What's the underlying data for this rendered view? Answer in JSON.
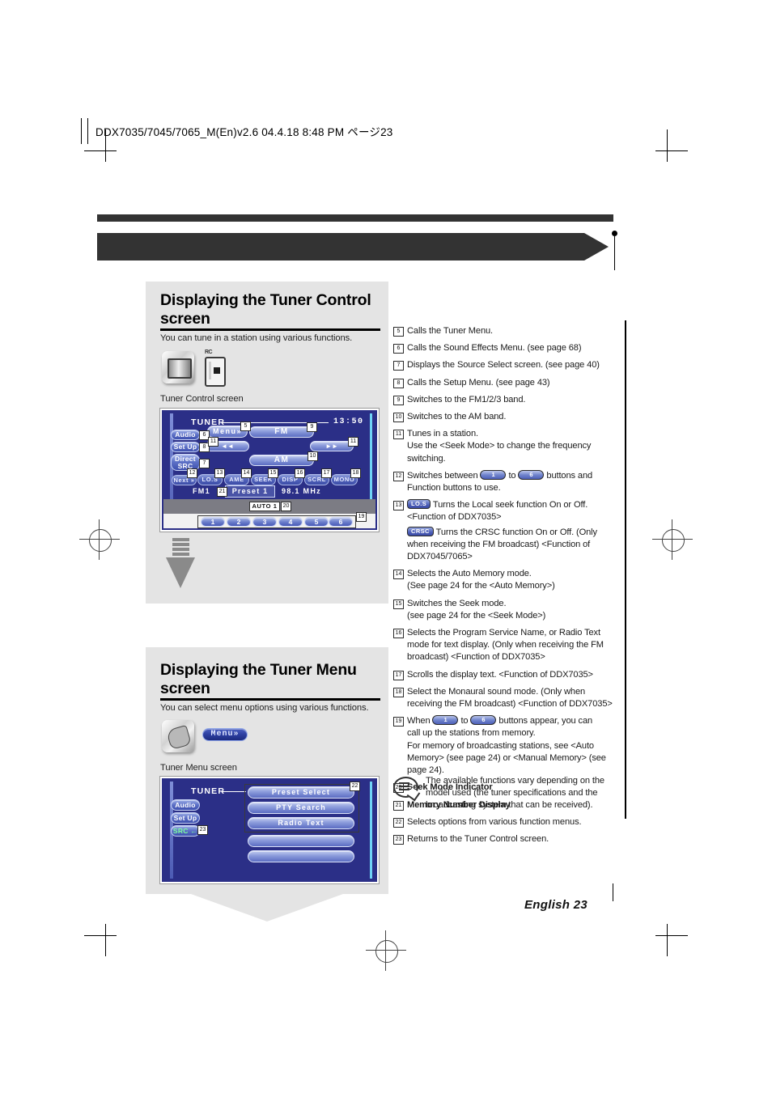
{
  "print_header": "DDX7035/7045/7065_M(En)v2.6  04.4.18  8:48 PM  ページ23",
  "footer": "English 23",
  "section1": {
    "heading": "Displaying the Tuner Control screen",
    "lead": "You can tune in a station using various functions.",
    "caption": "Tuner Control screen",
    "remote_icon_label": "RC",
    "screen": {
      "title": "TUNER",
      "clock": "13:50",
      "menu_button": "Menu»",
      "side_buttons": [
        "Audio",
        "Set Up",
        "Direct SRC"
      ],
      "band_fm": "FM",
      "band_am": "AM",
      "seek_left": "◄◄",
      "seek_right": "►►",
      "next_button": "Next »",
      "function_buttons": [
        "LO.S",
        "AME",
        "SEEK",
        "DISP",
        "SCRL",
        "MONO"
      ],
      "band_label": "FM1",
      "preset_label": "Preset 1",
      "frequency": "98.1 MHz",
      "auto_indicator": "AUTO 1",
      "preset_numbers": [
        "1",
        "2",
        "3",
        "4",
        "5",
        "6"
      ],
      "callouts": {
        "menu": "5",
        "audio": "6",
        "direct_src": "7",
        "setup": "8",
        "fm": "9",
        "am": "10",
        "seek_left": "11",
        "seek_right": "11",
        "next": "12",
        "los": "13",
        "ame": "14",
        "seek": "15",
        "disp": "16",
        "scrl": "17",
        "mono": "18",
        "presets": "19",
        "auto": "20",
        "preset_num": "21"
      }
    }
  },
  "section2": {
    "heading": "Displaying the Tuner Menu screen",
    "lead": "You can select menu options using various functions.",
    "caption": "Tuner Menu screen",
    "menu_pill": "Menu»",
    "screen": {
      "title": "TUNER",
      "side_buttons": [
        "Audio",
        "Set Up"
      ],
      "src_button": "SRC ←",
      "menu_items": [
        "Preset Select",
        "PTY Search",
        "Radio Text"
      ],
      "callouts": {
        "menu_list": "22",
        "src": "23"
      }
    }
  },
  "items": [
    {
      "num": "5",
      "lines": [
        {
          "text": "Calls the Tuner Menu."
        }
      ]
    },
    {
      "num": "6",
      "lines": [
        {
          "text": "Calls the Sound Effects Menu. (see page 68)"
        }
      ]
    },
    {
      "num": "7",
      "lines": [
        {
          "text": "Displays the Source Select screen. (see page 40)"
        }
      ]
    },
    {
      "num": "8",
      "lines": [
        {
          "text": "Calls the Setup Menu. (see page 43)"
        }
      ]
    },
    {
      "num": "9",
      "lines": [
        {
          "text": "Switches to the FM1/2/3 band."
        }
      ]
    },
    {
      "num": "10",
      "lines": [
        {
          "text": "Switches to the AM band."
        }
      ]
    },
    {
      "num": "11",
      "lines": [
        {
          "text": "Tunes in a station."
        },
        {
          "text": "Use the <Seek Mode> to change the frequency switching."
        }
      ]
    },
    {
      "num": "12",
      "pill_line": {
        "pre": "Switches between",
        "pill1": "1",
        "mid": "to",
        "pill2": "6",
        "post": "buttons and"
      },
      "lines": [
        {
          "text": "Function buttons to use."
        }
      ]
    },
    {
      "num": "13",
      "tag_line": {
        "tag": "LO.S",
        "text": "Turns the Local seek function On or Off. <Function of DDX7035>"
      },
      "tag_line2": {
        "tag": "CRSC",
        "text": "Turns the CRSC function On or Off. (Only when receiving the FM broadcast) <Function of DDX7045/7065>"
      },
      "lines": []
    },
    {
      "num": "14",
      "lines": [
        {
          "text": "Selects the Auto Memory mode."
        },
        {
          "text": "(See page 24 for the <Auto Memory>)"
        }
      ]
    },
    {
      "num": "15",
      "lines": [
        {
          "text": "Switches the Seek mode."
        },
        {
          "text": "(see page 24 for the <Seek Mode>)"
        }
      ]
    },
    {
      "num": "16",
      "lines": [
        {
          "text": "Selects the Program Service Name, or Radio Text mode for text display. (Only when receiving the FM broadcast) <Function of DDX7035>"
        }
      ]
    },
    {
      "num": "17",
      "lines": [
        {
          "text": "Scrolls the display text. <Function of DDX7035>"
        }
      ]
    },
    {
      "num": "18",
      "lines": [
        {
          "text": "Select the Monaural sound mode. (Only when receiving the FM broadcast) <Function of DDX7035>"
        }
      ]
    },
    {
      "num": "19",
      "pill_line": {
        "pre": "When",
        "pill1": "1",
        "mid": "to",
        "pill2": "6",
        "post": "buttons appear, you can"
      },
      "lines": [
        {
          "text": "call up the stations from memory."
        },
        {
          "text": "For memory of broadcasting stations, see <Auto Memory> (see page 24) or <Manual Memory> (see page 24)."
        }
      ]
    },
    {
      "num": "20",
      "bold": true,
      "lines": [
        {
          "text": "Seek Mode Indicator"
        }
      ]
    },
    {
      "num": "21",
      "bold": true,
      "lines": [
        {
          "text": "Memory Number Display"
        }
      ]
    },
    {
      "num": "22",
      "lines": [
        {
          "text": "Selects options from various function menus."
        }
      ]
    },
    {
      "num": "23",
      "lines": [
        {
          "text": "Returns to the Tuner Control screen."
        }
      ]
    }
  ],
  "note": "The available functions vary depending on the model used (the tuner specifications and the broadcasting system that can be received)."
}
